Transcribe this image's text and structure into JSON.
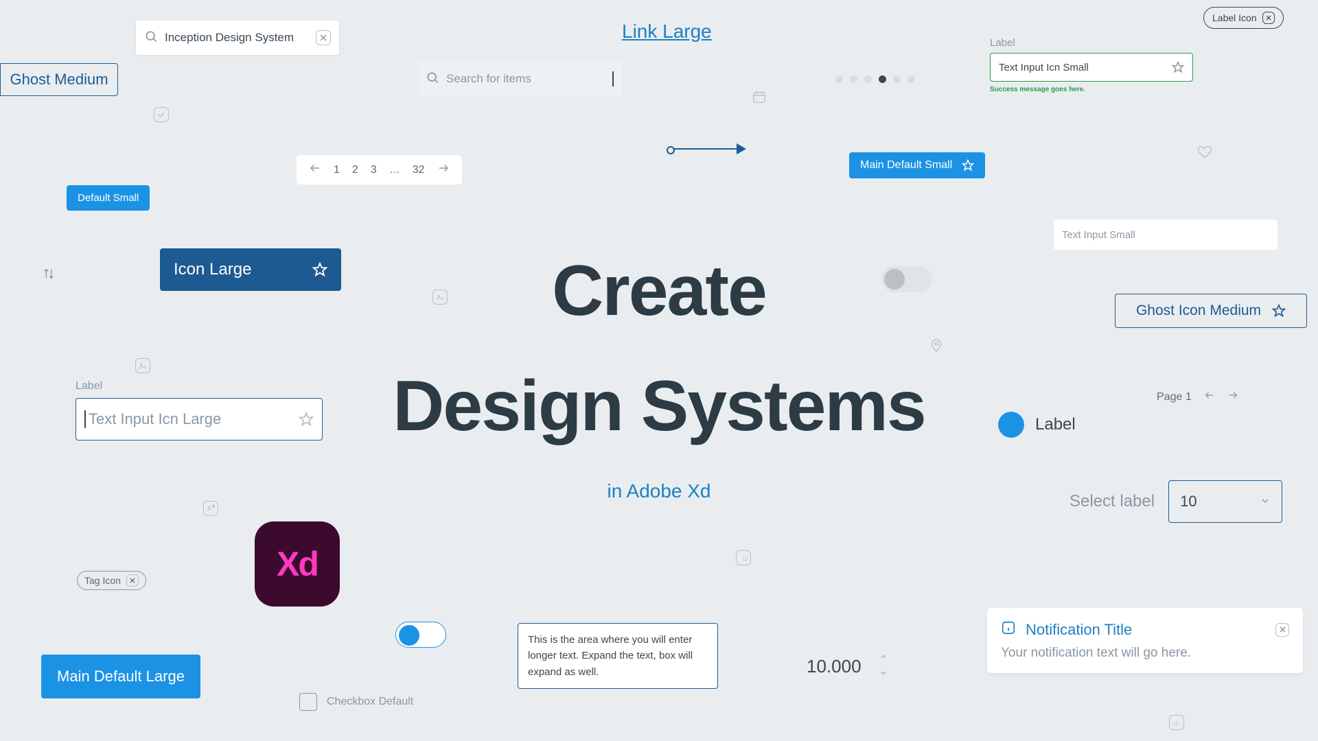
{
  "headline": {
    "line1": "Create",
    "line2": "Design Systems",
    "sub": "in Adobe Xd"
  },
  "link_large": "Link Large",
  "search_inception": {
    "value": "Inception Design System"
  },
  "search_items": {
    "placeholder": "Search for items"
  },
  "ghost_medium": "Ghost Medium",
  "default_small": "Default Small",
  "icon_large": "Icon Large",
  "input_icn_large": {
    "label": "Label",
    "placeholder": "Text Input Icn Large"
  },
  "input_icn_small": {
    "label": "Label",
    "value": "Text Input Icn Small",
    "success": "Success message goes here."
  },
  "text_input_small": {
    "placeholder": "Text Input Small"
  },
  "main_default_small": "Main Default Small",
  "main_default_large": "Main Default Large",
  "ghost_icon_medium": "Ghost Icon Medium",
  "label_icon_tag": "Label Icon",
  "tag_icon": "Tag Icon",
  "pager": {
    "first": "1",
    "second": "2",
    "third": "3",
    "ellipsis": "…",
    "last": "32"
  },
  "page_mini": "Page 1",
  "radio_label": "Label",
  "select": {
    "label": "Select label",
    "value": "10"
  },
  "stepper_value": "10.000",
  "textarea": "This is the area where you will enter longer text. Expand the text, box will expand as well.",
  "checkbox_label": "Checkbox Default",
  "notification": {
    "title": "Notification Title",
    "body": "Your notification text will go here."
  },
  "xd_logo_text": "Xd"
}
